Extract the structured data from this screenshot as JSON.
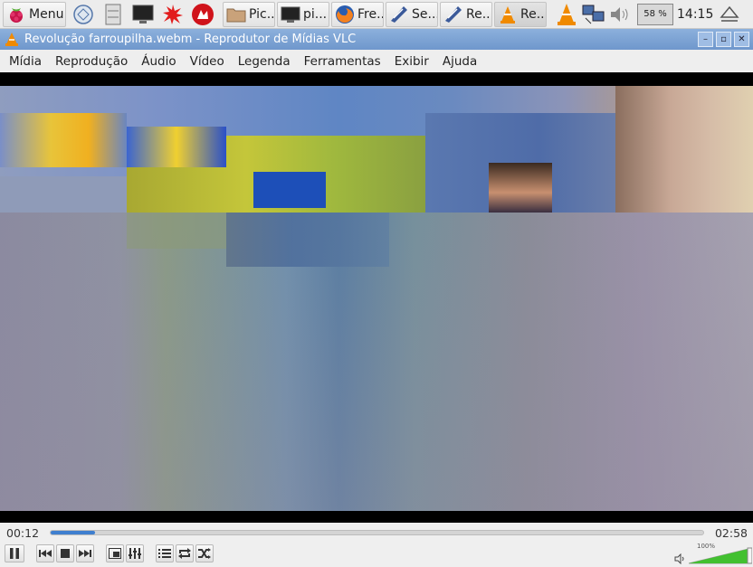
{
  "taskbar": {
    "menu_label": "Menu",
    "tasks": [
      {
        "label": "Pic...",
        "icon": "folder-icon"
      },
      {
        "label": "pi...",
        "icon": "terminal-icon"
      },
      {
        "label": "Fre...",
        "icon": "firefox-icon"
      },
      {
        "label": "Se...",
        "icon": "screenshot-icon"
      },
      {
        "label": "Re...",
        "icon": "screenshot-icon"
      },
      {
        "label": "Re...",
        "icon": "vlc-icon"
      }
    ],
    "cpu": "58 %",
    "clock": "14:15"
  },
  "window": {
    "title": "Revolução farroupilha.webm - Reprodutor de Mídias VLC"
  },
  "menu": {
    "items": [
      "Mídia",
      "Reprodução",
      "Áudio",
      "Vídeo",
      "Legenda",
      "Ferramentas",
      "Exibir",
      "Ajuda"
    ]
  },
  "player": {
    "current_time": "00:12",
    "total_time": "02:58",
    "progress": 0.068,
    "volume_label": "100%",
    "volume": 1.0
  },
  "colors": {
    "accent": "#3f7fcf",
    "titlebar": "#7aa0d2"
  }
}
